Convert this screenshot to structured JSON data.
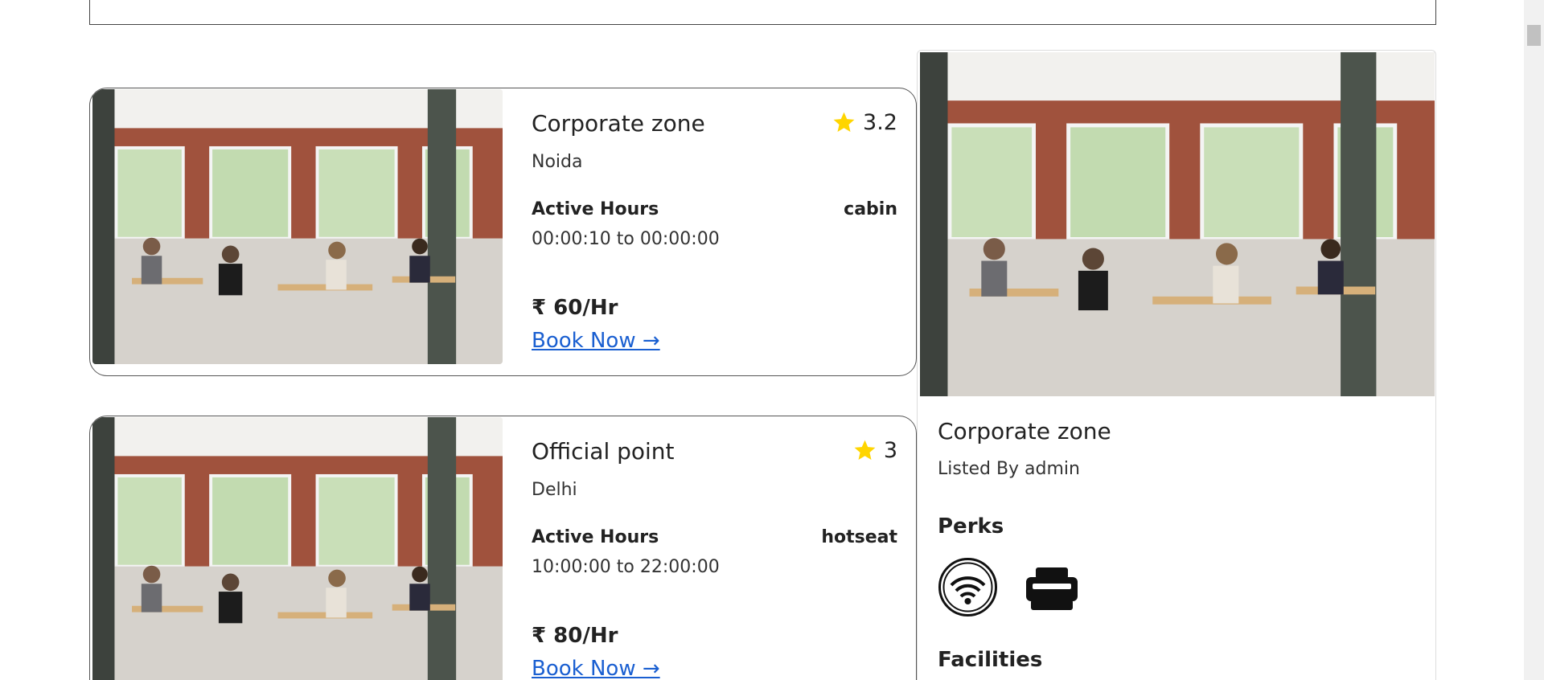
{
  "listings": [
    {
      "title": "Corporate zone",
      "rating": "3.2",
      "city": "Noida",
      "hours_label": "Active Hours",
      "type": "cabin",
      "hours": "00:00:10 to 00:00:00",
      "price": "₹ 60/Hr",
      "book_label": "Book Now →",
      "image_icon": "office-photo"
    },
    {
      "title": "Official point",
      "rating": "3",
      "city": "Delhi",
      "hours_label": "Active Hours",
      "type": "hotseat",
      "hours": "10:00:00 to 22:00:00",
      "price": "₹ 80/Hr",
      "book_label": "Book Now →",
      "image_icon": "office-photo"
    }
  ],
  "detail": {
    "title": "Corporate zone",
    "listed_by": "Listed By admin",
    "perks_heading": "Perks",
    "perks": [
      "wifi-icon",
      "printer-icon"
    ],
    "facilities_heading": "Facilities"
  },
  "colors": {
    "star": "#ffd500",
    "link": "#1a5fd1"
  }
}
